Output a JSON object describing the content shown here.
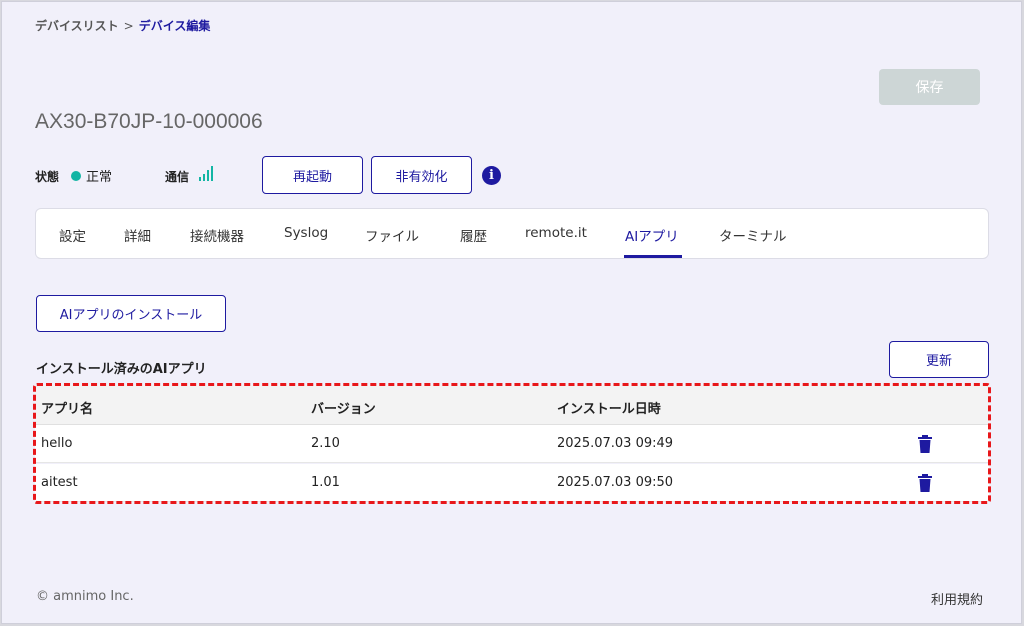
{
  "breadcrumb": {
    "parent": "デバイスリスト",
    "separator": ">",
    "current": "デバイス編集"
  },
  "toolbar": {
    "save_label": "保存"
  },
  "device": {
    "name": "AX30-B70JP-10-000006"
  },
  "status": {
    "state_label": "状態",
    "state_value": "正常",
    "comm_label": "通信",
    "signal_level": 4,
    "signal_max": 4,
    "colors": {
      "ok": "#13b5a4",
      "accent": "#1e1aa0"
    }
  },
  "actions": {
    "restart_label": "再起動",
    "disable_label": "非有効化",
    "info_icon": "info-icon"
  },
  "tabs": [
    {
      "label": "設定"
    },
    {
      "label": "詳細"
    },
    {
      "label": "接続機器"
    },
    {
      "label": "Syslog"
    },
    {
      "label": "ファイル"
    },
    {
      "label": "履歴"
    },
    {
      "label": "remote.it"
    },
    {
      "label": "AIアプリ",
      "active": true
    },
    {
      "label": "ターミナル"
    }
  ],
  "ai_apps": {
    "install_label": "AIアプリのインストール",
    "section_title": "インストール済みのAIアプリ",
    "refresh_label": "更新",
    "columns": {
      "name": "アプリ名",
      "version": "バージョン",
      "installed_at": "インストール日時"
    },
    "rows": [
      {
        "name": "hello",
        "version": "2.10",
        "installed_at": "2025.07.03 09:49",
        "action_icon": "trash-icon"
      },
      {
        "name": "aitest",
        "version": "1.01",
        "installed_at": "2025.07.03 09:50",
        "action_icon": "trash-icon"
      }
    ]
  },
  "footer": {
    "copyright": "© amnimo Inc.",
    "terms_label": "利用規約"
  }
}
